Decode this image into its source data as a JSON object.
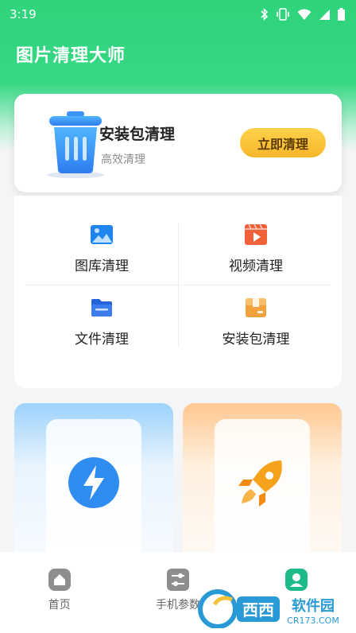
{
  "status_bar": {
    "time": "3:19",
    "icons": [
      "bluetooth-icon",
      "vibrate-icon",
      "wifi-icon",
      "signal-icon",
      "battery-icon"
    ]
  },
  "app": {
    "title": "图片清理大师",
    "accent_color": "#34d27f"
  },
  "hero": {
    "title": "安装包清理",
    "subtitle": "高效清理",
    "button_label": "立即清理",
    "icon": "trash-can-icon"
  },
  "tools": [
    {
      "label": "图库清理",
      "icon": "gallery-icon",
      "color": "#1f86f0"
    },
    {
      "label": "视频清理",
      "icon": "video-icon",
      "color": "#f0613a"
    },
    {
      "label": "文件清理",
      "icon": "folder-icon",
      "color": "#2563d9"
    },
    {
      "label": "安装包清理",
      "icon": "package-icon",
      "color": "#f2a23c"
    }
  ],
  "features": [
    {
      "icon": "lightning-icon",
      "color": "#2f8df2"
    },
    {
      "icon": "rocket-icon",
      "color": "#f7a21c"
    }
  ],
  "bottom_nav": [
    {
      "label": "首页",
      "icon": "home-icon"
    },
    {
      "label": "手机参数",
      "icon": "sliders-icon"
    },
    {
      "label": "",
      "icon": "profile-icon",
      "active": true
    }
  ],
  "watermark": {
    "brand": "西西软件园",
    "url": "CR173.COM"
  }
}
